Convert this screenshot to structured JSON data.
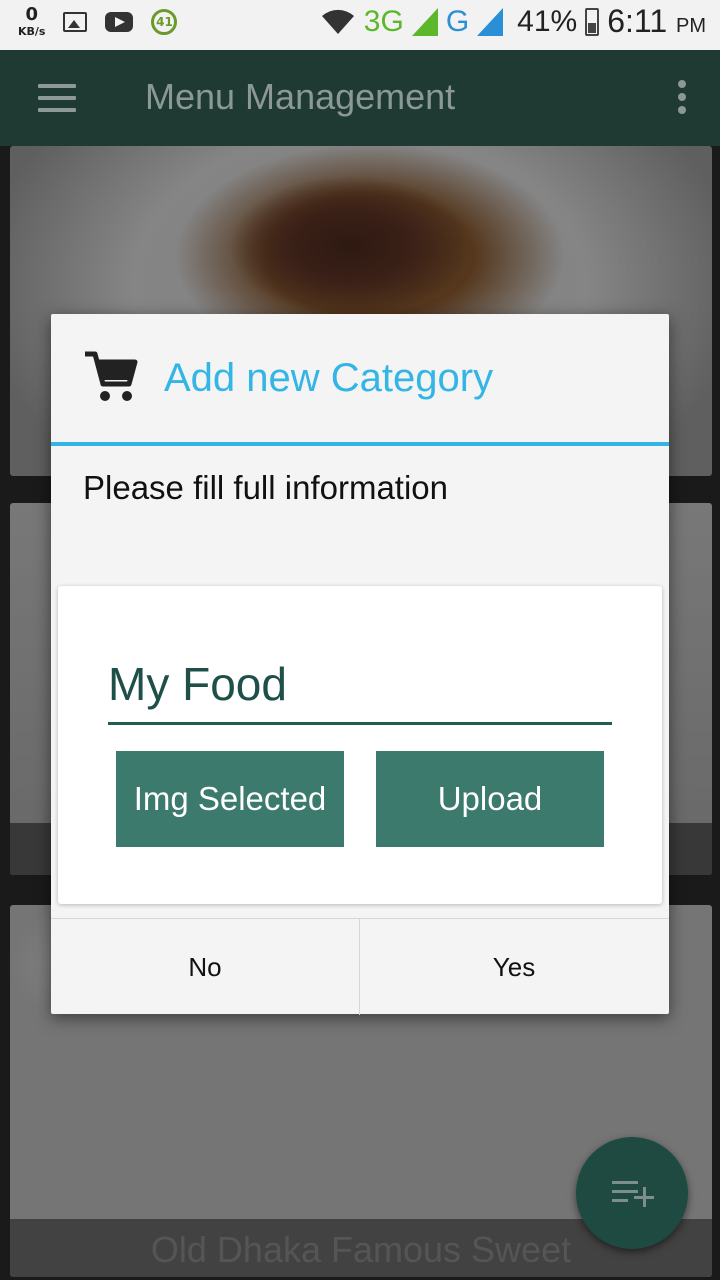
{
  "status_bar": {
    "speed_value": "0",
    "speed_unit": "KB/s",
    "badge": "41",
    "net1": "3G",
    "net2": "G",
    "battery": "41%",
    "time": "6:11",
    "ampm": "PM"
  },
  "appbar": {
    "title": "Menu Management",
    "menu_icon": "hamburger-icon",
    "overflow_icon": "more-vert-icon"
  },
  "cards": {
    "card3_caption": "Old Dhaka Famous Sweet"
  },
  "dialog": {
    "icon": "shopping-cart-icon",
    "title": "Add new Category",
    "message": "Please fill full information",
    "name_value": "My Food",
    "img_button": "Img Selected",
    "upload_button": "Upload",
    "no_button": "No",
    "yes_button": "Yes"
  },
  "fab": {
    "icon": "playlist-add-icon"
  },
  "colors": {
    "appbar": "#1f3a33",
    "accent": "#33b5e5",
    "button": "#3b7a6c",
    "input_text": "#1e4f49"
  }
}
